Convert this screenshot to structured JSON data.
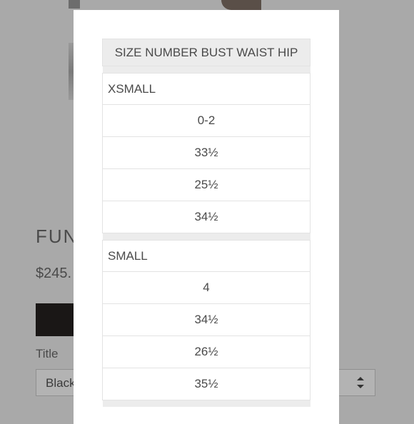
{
  "background_page": {
    "product_title": "FUN",
    "price": "$245.",
    "option_label": "Title",
    "option_value": "Black"
  },
  "modal": {
    "table_header": "SIZE NUMBER BUST WAIST HIP",
    "groups": [
      {
        "name": "XSMALL",
        "values": [
          "0-2",
          "33½",
          "25½",
          "34½"
        ]
      },
      {
        "name": "SMALL",
        "values": [
          "4",
          "34½",
          "26½",
          "35½"
        ]
      }
    ]
  },
  "colors": {
    "overlay_background": "#a9a9a9",
    "modal_background": "#ffffff",
    "header_background": "#ececec",
    "add_to_cart_button": "#1a1716"
  },
  "icons": {
    "select_arrows": "up-down-chevron-icon"
  }
}
